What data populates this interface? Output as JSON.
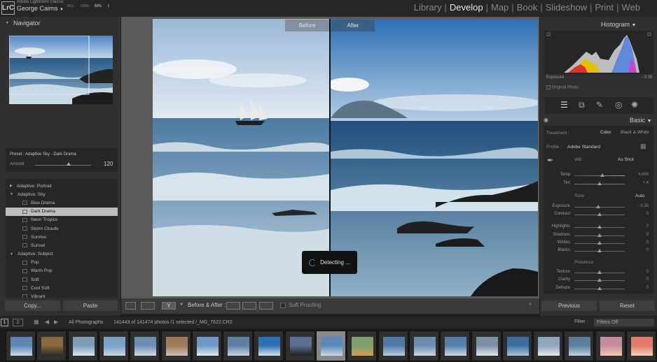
{
  "app": {
    "product": "Adobe Lightroom Classic",
    "user": "George Cairns",
    "logo": "LrC"
  },
  "modules": [
    {
      "label": "Library",
      "active": false
    },
    {
      "label": "Develop",
      "active": true
    },
    {
      "label": "Map",
      "active": false
    },
    {
      "label": "Book",
      "active": false
    },
    {
      "label": "Slideshow",
      "active": false
    },
    {
      "label": "Print",
      "active": false
    },
    {
      "label": "Web",
      "active": false
    }
  ],
  "navigator": {
    "title": "Navigator",
    "zoom": [
      "FILL",
      "100%",
      "50%"
    ],
    "zoom_active": "50%"
  },
  "preset_info": {
    "label": "Preset : Adaptive Sky - Dark Drama",
    "amount_label": "Amount",
    "amount_value": "120",
    "amount_fraction": 0.6
  },
  "presets": [
    {
      "label": "Adaptive: Portrait",
      "type": "group",
      "expanded": false
    },
    {
      "label": "Adaptive: Sky",
      "type": "group",
      "expanded": true
    },
    {
      "label": "Blue Drama",
      "type": "item"
    },
    {
      "label": "Dark Drama",
      "type": "item",
      "selected": true
    },
    {
      "label": "Neon Tropics",
      "type": "item"
    },
    {
      "label": "Storm Clouds",
      "type": "item"
    },
    {
      "label": "Sunrise",
      "type": "item"
    },
    {
      "label": "Sunset",
      "type": "item"
    },
    {
      "label": "Adaptive: Subject",
      "type": "group",
      "expanded": true
    },
    {
      "label": "Pop",
      "type": "item"
    },
    {
      "label": "Warm Pop",
      "type": "item"
    },
    {
      "label": "Soft",
      "type": "item"
    },
    {
      "label": "Cool Soft",
      "type": "item"
    },
    {
      "label": "Vibrant",
      "type": "item"
    }
  ],
  "left_buttons": {
    "copy": "Copy...",
    "paste": "Paste"
  },
  "view": {
    "before_label": "Before",
    "after_label": "After",
    "detecting": "Detecting ..."
  },
  "toolbar": {
    "before_after": "Before & After :",
    "soft_proofing": "Soft Proofing"
  },
  "histogram": {
    "title": "Histogram",
    "exposure_label": "Exposure",
    "exposure_value": "- 0.35",
    "original_photo": "Original Photo"
  },
  "basic": {
    "title": "Basic",
    "treatment_label": "Treatment :",
    "treatment_color": "Color",
    "treatment_bw": "Black & White",
    "profile_label": "Profile :",
    "profile_value": "Adobe Standard",
    "wb_label": "WB :",
    "wb_value": "As Shot",
    "temp": {
      "label": "Temp",
      "value": "4,900"
    },
    "tint": {
      "label": "Tint",
      "value": "+ 4"
    },
    "tone_label": "Tone",
    "auto_label": "Auto",
    "exposure": {
      "label": "Exposure",
      "value": "- 0.35"
    },
    "contrast": {
      "label": "Contrast",
      "value": "0"
    },
    "highlights": {
      "label": "Highlights",
      "value": "0"
    },
    "shadows": {
      "label": "Shadows",
      "value": "0"
    },
    "whites": {
      "label": "Whites",
      "value": "0"
    },
    "blacks": {
      "label": "Blacks",
      "value": "0"
    },
    "presence_label": "Presence",
    "texture": {
      "label": "Texture",
      "value": "0"
    },
    "clarity": {
      "label": "Clarity",
      "value": "0"
    },
    "dehaze": {
      "label": "Dehaze",
      "value": "0"
    }
  },
  "right_buttons": {
    "previous": "Previous",
    "reset": "Reset"
  },
  "filmbar": {
    "screen1": "1",
    "screen2": "2",
    "source": "All Photographs",
    "count": "141443 of 141474 photos /1 selected /_MG_7622.CR2",
    "filter_label": "Filter :",
    "filter_value": "Filters Off"
  },
  "colors": {
    "accent": "#4a8ad0",
    "panel": "#303030",
    "dark": "#262626"
  }
}
